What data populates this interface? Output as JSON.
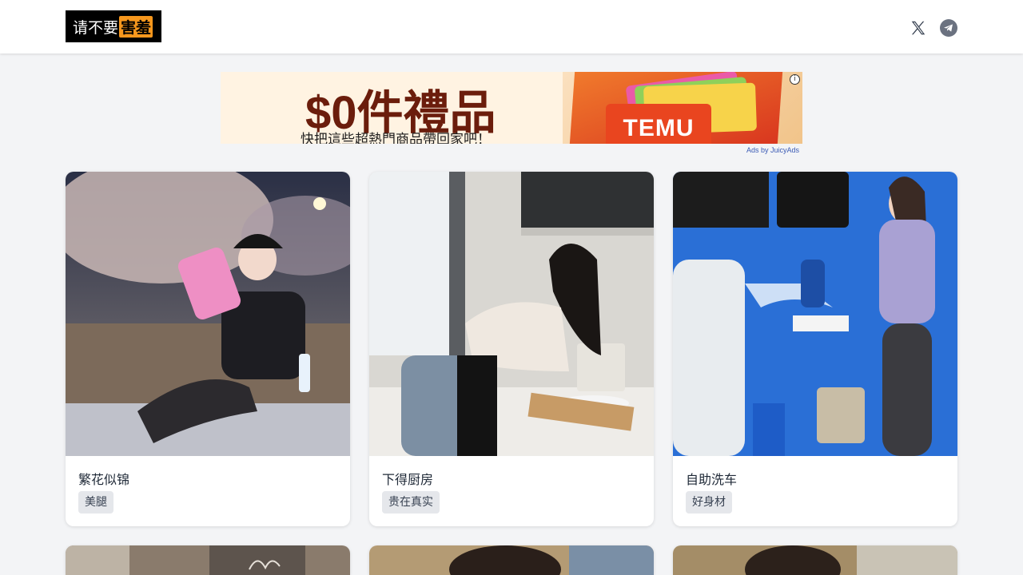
{
  "header": {
    "logo_part1": "请不要",
    "logo_part2": "害羞",
    "social": [
      {
        "icon": "x-twitter-icon"
      },
      {
        "icon": "telegram-icon"
      }
    ]
  },
  "ad": {
    "headline": "$0件禮品",
    "subline": "快把這些超熱門商品帶回家吧！",
    "brand": "TEMU",
    "info_symbol": "i",
    "credit": "Ads by JuicyAds"
  },
  "cards": [
    {
      "title": "繁花似锦",
      "tag": "美腿"
    },
    {
      "title": "下得厨房",
      "tag": "贵在真实"
    },
    {
      "title": "自助洗车",
      "tag": "好身材"
    }
  ],
  "colors": {
    "logo_bg": "#000000",
    "logo_accent": "#f7971d",
    "page_bg": "#f3f4f6",
    "tag_bg": "#e5e7eb"
  }
}
